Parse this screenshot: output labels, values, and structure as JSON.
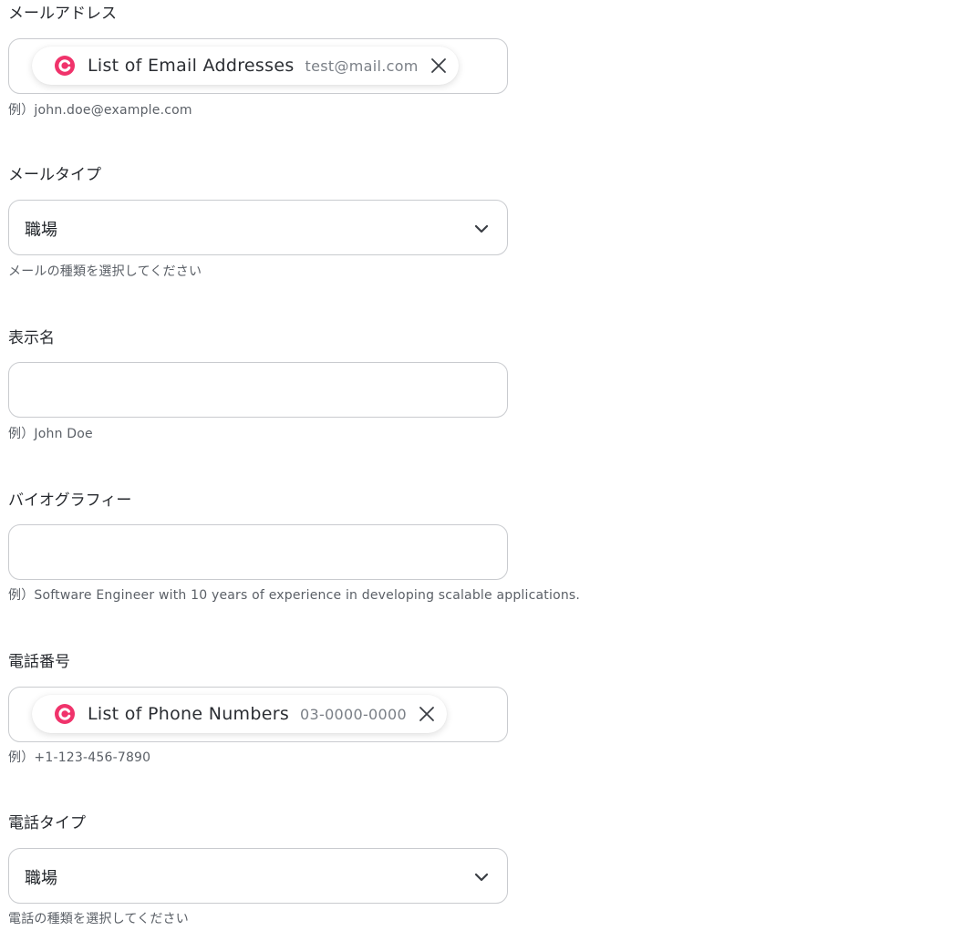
{
  "fields": {
    "email": {
      "label": "メールアドレス",
      "chip": {
        "icon": "yoom-logo-icon",
        "name": "List of Email Addresses",
        "value": "test@mail.com"
      },
      "hint": "例）john.doe@example.com"
    },
    "email_type": {
      "label": "メールタイプ",
      "selected": "職場",
      "hint": "メールの種類を選択してください"
    },
    "display_name": {
      "label": "表示名",
      "value": "",
      "hint": "例）John Doe"
    },
    "biography": {
      "label": "バイオグラフィー",
      "value": "",
      "hint": "例）Software Engineer with 10 years of experience in developing scalable applications."
    },
    "phone": {
      "label": "電話番号",
      "chip": {
        "icon": "yoom-logo-icon",
        "name": "List of Phone Numbers",
        "value": "03-0000-0000"
      },
      "hint": "例）+1-123-456-7890"
    },
    "phone_type": {
      "label": "電話タイプ",
      "selected": "職場",
      "hint": "電話の種類を選択してください"
    }
  },
  "colors": {
    "chip_icon": "#f0336b",
    "border": "#c9cbcf",
    "hint": "#5b6067"
  }
}
